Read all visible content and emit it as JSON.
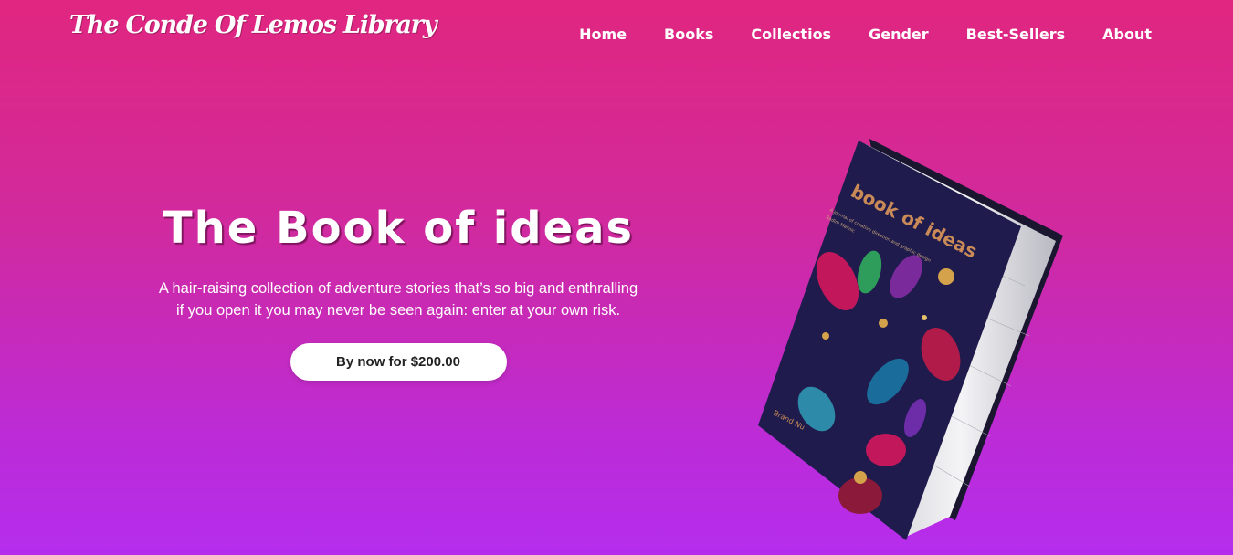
{
  "header": {
    "logo_text": "The Conde Of Lemos Library",
    "nav": [
      "Home",
      "Books",
      "Collectios",
      "Gender",
      "Best-Sellers",
      "About"
    ]
  },
  "hero": {
    "title": "The Book of ideas",
    "description_line1": "A hair-raising collection of adventure stories that’s so big and enthralling",
    "description_line2": "if you open it you may never be seen again: enter at your own risk.",
    "cta_label": "By now for $200.00"
  },
  "book_cover": {
    "title": "book of ideas",
    "subtitle": "A journal of creative direction and graphic design",
    "author": "Radim Malinic",
    "publisher": "Brand Nu"
  },
  "colors": {
    "gradient_top": "#e0267f",
    "gradient_bottom": "#b52ded",
    "button_bg": "#ffffff",
    "cover_bg": "#1f1c4d"
  }
}
